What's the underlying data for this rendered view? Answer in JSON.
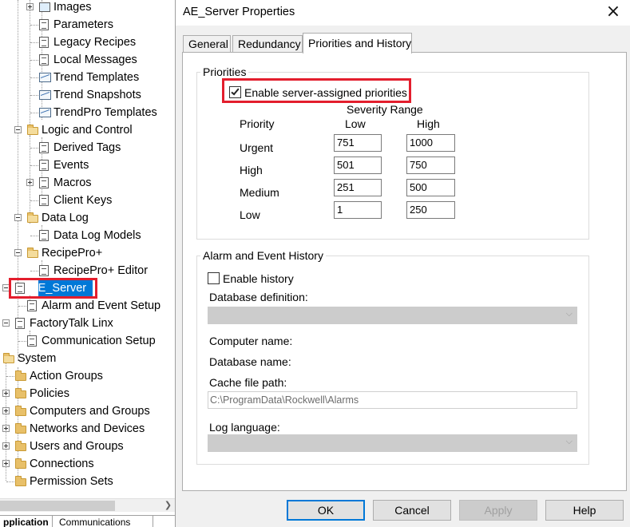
{
  "tree": {
    "items": [
      {
        "label": "Images",
        "icon": "image-icon"
      },
      {
        "label": "Parameters",
        "icon": "document-icon"
      },
      {
        "label": "Legacy Recipes",
        "icon": "recipe-icon"
      },
      {
        "label": "Local Messages",
        "icon": "message-icon"
      },
      {
        "label": "Trend Templates",
        "icon": "trend-icon"
      },
      {
        "label": "Trend Snapshots",
        "icon": "trend-icon"
      },
      {
        "label": "TrendPro Templates",
        "icon": "trend-icon"
      },
      {
        "label": "Logic and Control",
        "icon": "folder-open-icon"
      },
      {
        "label": "Derived Tags",
        "icon": "derived-tag-icon"
      },
      {
        "label": "Events",
        "icon": "clock-icon"
      },
      {
        "label": "Macros",
        "icon": "macro-icon"
      },
      {
        "label": "Client Keys",
        "icon": "key-icon"
      },
      {
        "label": "Data Log",
        "icon": "folder-open-icon"
      },
      {
        "label": "Data Log Models",
        "icon": "database-icon"
      },
      {
        "label": "RecipePro+",
        "icon": "folder-open-icon"
      },
      {
        "label": "RecipePro+ Editor",
        "icon": "editor-icon"
      },
      {
        "label": "AE_Server",
        "icon": "server-icon"
      },
      {
        "label": "Alarm and Event Setup",
        "icon": "alarm-icon"
      },
      {
        "label": "FactoryTalk Linx",
        "icon": "linx-icon"
      },
      {
        "label": "Communication Setup",
        "icon": "communication-icon"
      },
      {
        "label": "System",
        "icon": "folder-open-icon"
      },
      {
        "label": "Action Groups",
        "icon": "folder-icon"
      },
      {
        "label": "Policies",
        "icon": "folder-icon"
      },
      {
        "label": "Computers and Groups",
        "icon": "folder-icon"
      },
      {
        "label": "Networks and Devices",
        "icon": "folder-icon"
      },
      {
        "label": "Users and Groups",
        "icon": "folder-icon"
      },
      {
        "label": "Connections",
        "icon": "folder-icon"
      },
      {
        "label": "Permission Sets",
        "icon": "folder-icon"
      }
    ],
    "bottom_tabs": [
      "pplication",
      "Communications"
    ]
  },
  "dialog": {
    "title": "AE_Server Properties",
    "tabs": [
      "General",
      "Redundancy",
      "Priorities and History"
    ],
    "priorities": {
      "legend": "Priorities",
      "enable_label": "Enable server-assigned priorities",
      "enable_checked": true,
      "severity_range": "Severity Range",
      "col_priority": "Priority",
      "col_low": "Low",
      "col_high": "High",
      "rows": [
        {
          "name": "Urgent",
          "low": "751",
          "high": "1000"
        },
        {
          "name": "High",
          "low": "501",
          "high": "750"
        },
        {
          "name": "Medium",
          "low": "251",
          "high": "500"
        },
        {
          "name": "Low",
          "low": "1",
          "high": "250"
        }
      ]
    },
    "history": {
      "legend": "Alarm and Event History",
      "enable_label": "Enable history",
      "enable_checked": false,
      "db_definition_label": "Database definition:",
      "computer_name_label": "Computer name:",
      "database_name_label": "Database name:",
      "cache_path_label": "Cache file path:",
      "cache_path_value": "C:\\ProgramData\\Rockwell\\Alarms",
      "log_language_label": "Log language:"
    },
    "buttons": {
      "ok": "OK",
      "cancel": "Cancel",
      "apply": "Apply",
      "help": "Help"
    }
  },
  "colors": {
    "highlight_red": "#e31e2d",
    "selection_blue": "#0078d7"
  }
}
